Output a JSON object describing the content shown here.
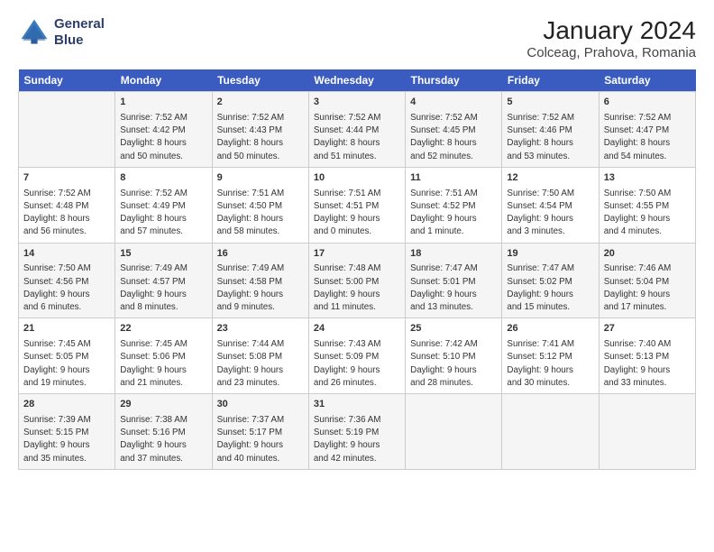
{
  "logo": {
    "line1": "General",
    "line2": "Blue"
  },
  "title": "January 2024",
  "subtitle": "Colceag, Prahova, Romania",
  "days_header": [
    "Sunday",
    "Monday",
    "Tuesday",
    "Wednesday",
    "Thursday",
    "Friday",
    "Saturday"
  ],
  "weeks": [
    [
      {
        "num": "",
        "info": ""
      },
      {
        "num": "1",
        "info": "Sunrise: 7:52 AM\nSunset: 4:42 PM\nDaylight: 8 hours\nand 50 minutes."
      },
      {
        "num": "2",
        "info": "Sunrise: 7:52 AM\nSunset: 4:43 PM\nDaylight: 8 hours\nand 50 minutes."
      },
      {
        "num": "3",
        "info": "Sunrise: 7:52 AM\nSunset: 4:44 PM\nDaylight: 8 hours\nand 51 minutes."
      },
      {
        "num": "4",
        "info": "Sunrise: 7:52 AM\nSunset: 4:45 PM\nDaylight: 8 hours\nand 52 minutes."
      },
      {
        "num": "5",
        "info": "Sunrise: 7:52 AM\nSunset: 4:46 PM\nDaylight: 8 hours\nand 53 minutes."
      },
      {
        "num": "6",
        "info": "Sunrise: 7:52 AM\nSunset: 4:47 PM\nDaylight: 8 hours\nand 54 minutes."
      }
    ],
    [
      {
        "num": "7",
        "info": "Sunrise: 7:52 AM\nSunset: 4:48 PM\nDaylight: 8 hours\nand 56 minutes."
      },
      {
        "num": "8",
        "info": "Sunrise: 7:52 AM\nSunset: 4:49 PM\nDaylight: 8 hours\nand 57 minutes."
      },
      {
        "num": "9",
        "info": "Sunrise: 7:51 AM\nSunset: 4:50 PM\nDaylight: 8 hours\nand 58 minutes."
      },
      {
        "num": "10",
        "info": "Sunrise: 7:51 AM\nSunset: 4:51 PM\nDaylight: 9 hours\nand 0 minutes."
      },
      {
        "num": "11",
        "info": "Sunrise: 7:51 AM\nSunset: 4:52 PM\nDaylight: 9 hours\nand 1 minute."
      },
      {
        "num": "12",
        "info": "Sunrise: 7:50 AM\nSunset: 4:54 PM\nDaylight: 9 hours\nand 3 minutes."
      },
      {
        "num": "13",
        "info": "Sunrise: 7:50 AM\nSunset: 4:55 PM\nDaylight: 9 hours\nand 4 minutes."
      }
    ],
    [
      {
        "num": "14",
        "info": "Sunrise: 7:50 AM\nSunset: 4:56 PM\nDaylight: 9 hours\nand 6 minutes."
      },
      {
        "num": "15",
        "info": "Sunrise: 7:49 AM\nSunset: 4:57 PM\nDaylight: 9 hours\nand 8 minutes."
      },
      {
        "num": "16",
        "info": "Sunrise: 7:49 AM\nSunset: 4:58 PM\nDaylight: 9 hours\nand 9 minutes."
      },
      {
        "num": "17",
        "info": "Sunrise: 7:48 AM\nSunset: 5:00 PM\nDaylight: 9 hours\nand 11 minutes."
      },
      {
        "num": "18",
        "info": "Sunrise: 7:47 AM\nSunset: 5:01 PM\nDaylight: 9 hours\nand 13 minutes."
      },
      {
        "num": "19",
        "info": "Sunrise: 7:47 AM\nSunset: 5:02 PM\nDaylight: 9 hours\nand 15 minutes."
      },
      {
        "num": "20",
        "info": "Sunrise: 7:46 AM\nSunset: 5:04 PM\nDaylight: 9 hours\nand 17 minutes."
      }
    ],
    [
      {
        "num": "21",
        "info": "Sunrise: 7:45 AM\nSunset: 5:05 PM\nDaylight: 9 hours\nand 19 minutes."
      },
      {
        "num": "22",
        "info": "Sunrise: 7:45 AM\nSunset: 5:06 PM\nDaylight: 9 hours\nand 21 minutes."
      },
      {
        "num": "23",
        "info": "Sunrise: 7:44 AM\nSunset: 5:08 PM\nDaylight: 9 hours\nand 23 minutes."
      },
      {
        "num": "24",
        "info": "Sunrise: 7:43 AM\nSunset: 5:09 PM\nDaylight: 9 hours\nand 26 minutes."
      },
      {
        "num": "25",
        "info": "Sunrise: 7:42 AM\nSunset: 5:10 PM\nDaylight: 9 hours\nand 28 minutes."
      },
      {
        "num": "26",
        "info": "Sunrise: 7:41 AM\nSunset: 5:12 PM\nDaylight: 9 hours\nand 30 minutes."
      },
      {
        "num": "27",
        "info": "Sunrise: 7:40 AM\nSunset: 5:13 PM\nDaylight: 9 hours\nand 33 minutes."
      }
    ],
    [
      {
        "num": "28",
        "info": "Sunrise: 7:39 AM\nSunset: 5:15 PM\nDaylight: 9 hours\nand 35 minutes."
      },
      {
        "num": "29",
        "info": "Sunrise: 7:38 AM\nSunset: 5:16 PM\nDaylight: 9 hours\nand 37 minutes."
      },
      {
        "num": "30",
        "info": "Sunrise: 7:37 AM\nSunset: 5:17 PM\nDaylight: 9 hours\nand 40 minutes."
      },
      {
        "num": "31",
        "info": "Sunrise: 7:36 AM\nSunset: 5:19 PM\nDaylight: 9 hours\nand 42 minutes."
      },
      {
        "num": "",
        "info": ""
      },
      {
        "num": "",
        "info": ""
      },
      {
        "num": "",
        "info": ""
      }
    ]
  ]
}
